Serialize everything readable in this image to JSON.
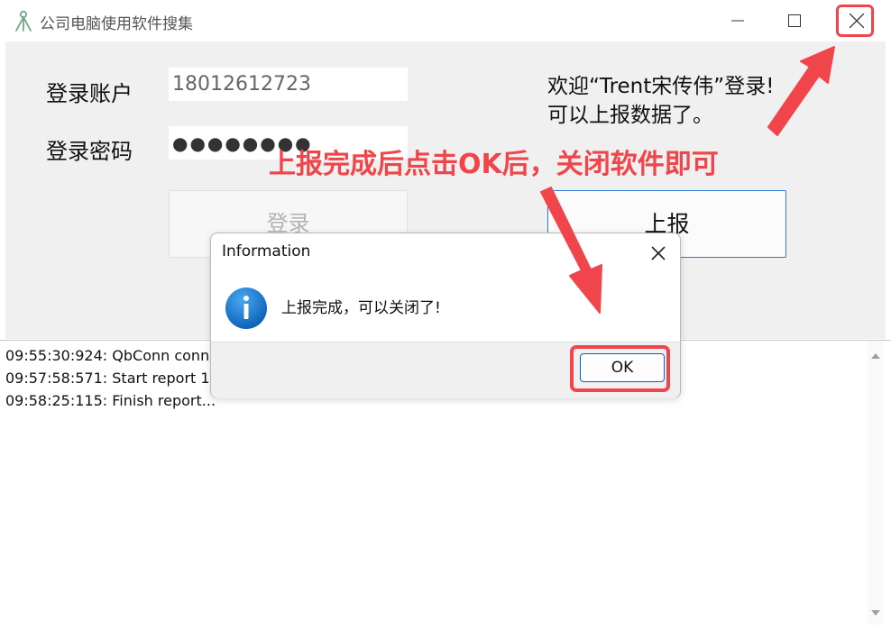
{
  "window": {
    "title": "公司电脑使用软件搜集",
    "icon": "app-tripod-icon"
  },
  "form": {
    "account_label": "登录账户",
    "account_value": "18012612723",
    "password_label": "登录密码",
    "password_value": "●●●●●●●●",
    "login_button": "登录",
    "report_button": "上报"
  },
  "welcome": {
    "line1": "欢迎“Trent宋传伟”登录!",
    "line2": "可以上报数据了。"
  },
  "annotation": {
    "text": "上报完成后点击OK后，关闭软件即可",
    "color": "#f0464b"
  },
  "log": {
    "lines": [
      "09:55:30:924: QbConn conne",
      "09:57:58:571: Start report 16E",
      "09:58:25:115: Finish report..."
    ]
  },
  "dialog": {
    "title": "Information",
    "message": "上报完成，可以关闭了!",
    "ok_label": "OK",
    "icon": "info-icon"
  },
  "colors": {
    "accent": "#0067c0",
    "highlight": "#f0464b",
    "panel": "#f0f0f0"
  }
}
